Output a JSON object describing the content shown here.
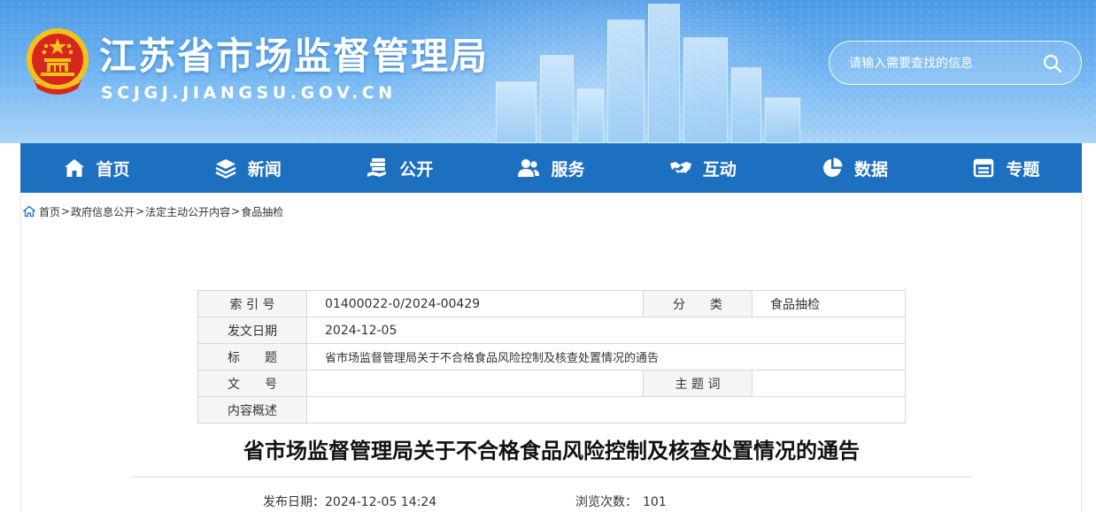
{
  "header": {
    "site_title": "江苏省市场监督管理局",
    "site_domain": "SCJGJ.JIANGSU.GOV.CN",
    "search_placeholder": "请输入需要查找的信息"
  },
  "nav": {
    "items": [
      {
        "label": "首页",
        "icon": "home-icon"
      },
      {
        "label": "新闻",
        "icon": "layers-icon"
      },
      {
        "label": "公开",
        "icon": "stack-hand-icon"
      },
      {
        "label": "服务",
        "icon": "users-icon"
      },
      {
        "label": "互动",
        "icon": "handshake-icon"
      },
      {
        "label": "数据",
        "icon": "pie-chart-icon"
      },
      {
        "label": "专题",
        "icon": "window-icon"
      }
    ]
  },
  "breadcrumb": {
    "items": [
      "首页",
      "政府信息公开",
      "法定主动公开内容",
      "食品抽检"
    ],
    "separator": ">"
  },
  "meta_table": {
    "index_label": "索 引 号",
    "index_value": "01400022-0/2024-00429",
    "category_label": "分　　类",
    "category_value": "食品抽检",
    "date_label": "发文日期",
    "date_value": "2024-12-05",
    "title_label": "标　　题",
    "title_value": "省市场监督管理局关于不合格食品风险控制及核查处置情况的通告",
    "doc_no_label": "文　　号",
    "doc_no_value": "",
    "keyword_label": "主 题 词",
    "keyword_value": "",
    "summary_label": "内容概述",
    "summary_value": ""
  },
  "article": {
    "title": "省市场监督管理局关于不合格食品风险控制及核查处置情况的通告",
    "publish_label": "发布日期：",
    "publish_value": "2024-12-05 14:24",
    "views_label": "浏览次数：",
    "views_value": "101"
  },
  "colors": {
    "nav_bg": "#1d6fc0",
    "banner_top": "#4d9ae6",
    "emblem_red": "#d7261e",
    "emblem_gold": "#f2c21b"
  }
}
